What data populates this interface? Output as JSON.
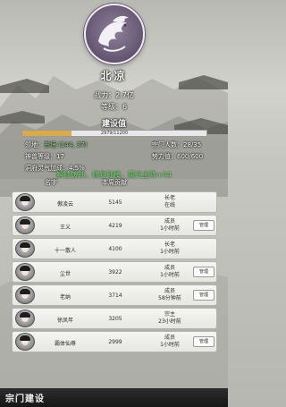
{
  "header": {
    "sect_name": "北凉",
    "power_label": "战力：",
    "power_value": "2.7亿",
    "level_label": "等级：",
    "level_value": "6"
  },
  "construction": {
    "title": "建设值",
    "progress_text": "2979/11200",
    "progress_fraction": 0.266
  },
  "info": {
    "location_label": "领地：",
    "location_value": "东境 (144, 37)",
    "members_label": "宗门人数：",
    "members_value": "28/35",
    "beast_label": "神兽等级：",
    "beast_value": "17",
    "force_label": "势力值：",
    "force_value": "600/600",
    "spirit_label": "洞府灵气加成：",
    "spirit_value": "4.5%"
  },
  "overlay_message": "解锁铸钟，修复钟楼，属元主阵+44",
  "columns": {
    "name": "名字",
    "contribution": "本周贡献"
  },
  "members": [
    {
      "name": "傲凌云",
      "power": "5145",
      "role": "长老",
      "status": "在线",
      "show_button": false
    },
    {
      "name": "王义",
      "power": "4219",
      "role": "成员",
      "status": "1小时前",
      "show_button": true
    },
    {
      "name": "十一散人",
      "power": "4100",
      "role": "长老",
      "status": "1小时前",
      "show_button": false
    },
    {
      "name": "尘世",
      "power": "3922",
      "role": "成员",
      "status": "1小时前",
      "show_button": true
    },
    {
      "name": "老纳",
      "power": "3714",
      "role": "成员",
      "status": "58分钟前",
      "show_button": true
    },
    {
      "name": "徐凤年",
      "power": "3205",
      "role": "宗主",
      "status": "23小时前",
      "show_button": false
    },
    {
      "name": "霸体仙尊",
      "power": "2999",
      "role": "成员",
      "status": "1小时前",
      "show_button": true
    }
  ],
  "manage_label": "管理",
  "bottom": {
    "label": "宗门建设"
  },
  "colors": {
    "emblem": "#6e5f7b",
    "progress_fill": "#d9a94a",
    "highlight_green": "#5ee05e"
  }
}
